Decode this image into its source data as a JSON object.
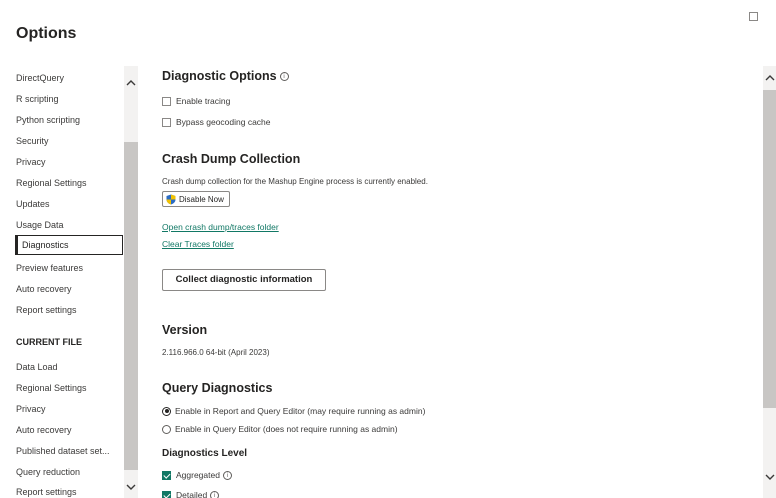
{
  "window": {
    "title": "Options"
  },
  "sidebar": {
    "global_items": [
      {
        "label": "DirectQuery"
      },
      {
        "label": "R scripting"
      },
      {
        "label": "Python scripting"
      },
      {
        "label": "Security"
      },
      {
        "label": "Privacy"
      },
      {
        "label": "Regional Settings"
      },
      {
        "label": "Updates"
      },
      {
        "label": "Usage Data"
      },
      {
        "label": "Diagnostics"
      },
      {
        "label": "Preview features"
      },
      {
        "label": "Auto recovery"
      },
      {
        "label": "Report settings"
      }
    ],
    "selected": "Diagnostics",
    "current_file_heading": "CURRENT FILE",
    "current_file_items": [
      {
        "label": "Data Load"
      },
      {
        "label": "Regional Settings"
      },
      {
        "label": "Privacy"
      },
      {
        "label": "Auto recovery"
      },
      {
        "label": "Published dataset set..."
      },
      {
        "label": "Query reduction"
      },
      {
        "label": "Report settings"
      }
    ]
  },
  "diagnostic_options": {
    "heading": "Diagnostic Options",
    "enable_tracing": {
      "label": "Enable tracing",
      "checked": false
    },
    "bypass_geocoding": {
      "label": "Bypass geocoding cache",
      "checked": false
    }
  },
  "crash_dump": {
    "heading": "Crash Dump Collection",
    "description": "Crash dump collection for the Mashup Engine process is currently enabled.",
    "disable_button": "Disable Now",
    "open_folder_link": "Open crash dump/traces folder",
    "clear_traces_link": "Clear Traces folder",
    "collect_button": "Collect diagnostic information"
  },
  "version": {
    "heading": "Version",
    "value": "2.116.966.0 64-bit (April 2023)"
  },
  "query_diagnostics": {
    "heading": "Query Diagnostics",
    "options": [
      {
        "label": "Enable in Report and Query Editor (may require running as admin)",
        "checked": true
      },
      {
        "label": "Enable in Query Editor (does not require running as admin)",
        "checked": false
      }
    ],
    "level_heading": "Diagnostics Level",
    "levels": [
      {
        "label": "Aggregated",
        "checked": true
      },
      {
        "label": "Detailed",
        "checked": true
      }
    ]
  },
  "colors": {
    "accent": "#117865",
    "text": "#252423"
  }
}
